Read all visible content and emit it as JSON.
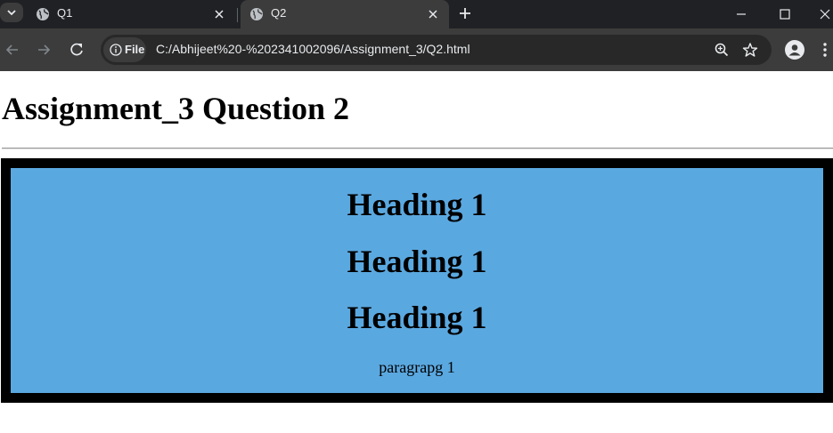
{
  "browser": {
    "tabs": [
      {
        "title": "Q1",
        "active": false
      },
      {
        "title": "Q2",
        "active": true
      }
    ],
    "site_chip_label": "File",
    "address_url": "C:/Abhijeet%20-%202341002096/Assignment_3/Q2.html",
    "icons": [
      "tab-search-icon",
      "globe-icon",
      "close-icon",
      "plus-icon",
      "minimize-icon",
      "maximize-icon",
      "window-close-icon",
      "back-icon",
      "forward-icon",
      "reload-icon",
      "info-icon",
      "zoom-icon",
      "star-icon",
      "profile-icon",
      "menu-icon"
    ],
    "colors": {
      "tabstrip": "#202124",
      "toolbar": "#3c3c3c",
      "omnibox": "#282828",
      "text": "#e8eaed"
    }
  },
  "page": {
    "title": "Assignment_3 Question 2",
    "box": {
      "headings": [
        "Heading 1",
        "Heading 1",
        "Heading 1"
      ],
      "paragraph": "paragrapg 1",
      "colors": {
        "background": "#5aa8e0",
        "border": "#000000"
      }
    }
  }
}
